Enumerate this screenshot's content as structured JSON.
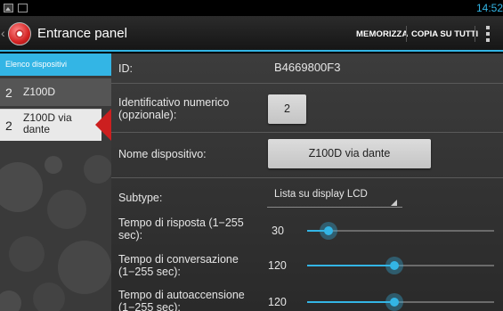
{
  "status_bar": {
    "time": "14:52",
    "icons": [
      "gallery-notification-icon",
      "message-notification-icon"
    ]
  },
  "action_bar": {
    "title": "Entrance panel",
    "actions": [
      "MEMORIZZA",
      "COPIA SU TUTTI"
    ],
    "overflow_icon": "overflow-menu-icon",
    "accent_color": "#33b5e5"
  },
  "device_list": {
    "header": "Elenco dispositivi",
    "items": [
      {
        "number": "2",
        "name": "Z100D",
        "selected": false
      },
      {
        "number": "2",
        "name": "Z100D via dante",
        "selected": true
      }
    ],
    "selection_marker_color": "#cc1f1f"
  },
  "details": {
    "id_label": "ID:",
    "id_value": "B4669800F3",
    "numeric_id_label": "Identificativo numerico (opzionale):",
    "numeric_id_value": "2",
    "name_label": "Nome dispositivo:",
    "name_value": "Z100D via dante",
    "subtype_label": "Subtype:",
    "subtype_value": "Lista su display LCD",
    "sliders": [
      {
        "label": "Tempo di risposta (1−255 sec):",
        "value": "30",
        "min": 1,
        "max": 255
      },
      {
        "label": "Tempo di conversazione (1−255 sec):",
        "value": "120",
        "min": 1,
        "max": 255
      },
      {
        "label": "Tempo di autoaccensione (1−255 sec):",
        "value": "120",
        "min": 1,
        "max": 255
      }
    ]
  }
}
